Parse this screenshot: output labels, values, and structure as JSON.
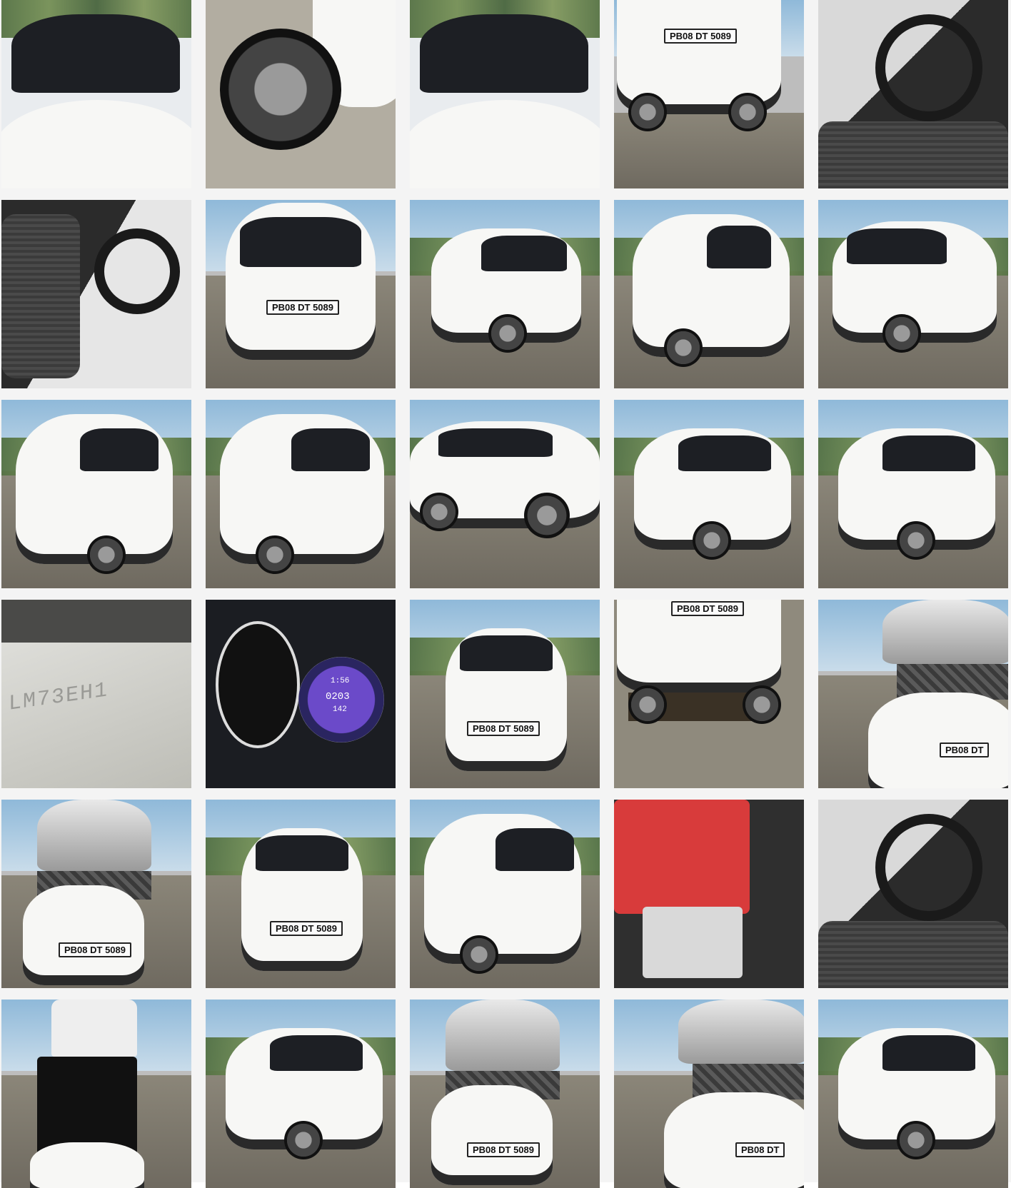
{
  "gallery": {
    "plate_text": "PB08 DT 5089",
    "plate_text_cropped": "PB08 DT",
    "tiles": [
      {
        "scene": "windshield-front"
      },
      {
        "scene": "wheel-closeup"
      },
      {
        "scene": "windshield-front"
      },
      {
        "scene": "front-bumper",
        "plate": "PB08 DT 5089"
      },
      {
        "scene": "interior-steering"
      },
      {
        "scene": "interior-seats"
      },
      {
        "scene": "rear-view",
        "plate": "PB08 DT 5089"
      },
      {
        "scene": "front-three-quarter-left"
      },
      {
        "scene": "rear-three-quarter"
      },
      {
        "scene": "front-three-quarter-right"
      },
      {
        "scene": "rear-three-quarter-left"
      },
      {
        "scene": "rear-three-quarter"
      },
      {
        "scene": "side-profile"
      },
      {
        "scene": "front-three-quarter-left"
      },
      {
        "scene": "front-three-quarter-left"
      },
      {
        "scene": "vin-plate"
      },
      {
        "scene": "instrument-cluster",
        "odometer": "0203",
        "trip": "142",
        "clock": "1:56"
      },
      {
        "scene": "front-view",
        "plate": "PB08 DT 5089"
      },
      {
        "scene": "underbody",
        "plate": "PB08 DT 5089"
      },
      {
        "scene": "engine-bay-right",
        "plate": "PB08 DT"
      },
      {
        "scene": "engine-bay-front",
        "plate": "PB08 DT 5089"
      },
      {
        "scene": "front-view",
        "plate": "PB08 DT 5089"
      },
      {
        "scene": "rear-three-quarter"
      },
      {
        "scene": "battery"
      },
      {
        "scene": "interior-steering"
      },
      {
        "scene": "boot-open"
      },
      {
        "scene": "front-three-quarter-left"
      },
      {
        "scene": "engine-bay-front",
        "plate": "PB08 DT 5089"
      },
      {
        "scene": "engine-bay-right",
        "plate": "PB08 DT"
      },
      {
        "scene": "front-three-quarter-left"
      }
    ]
  }
}
